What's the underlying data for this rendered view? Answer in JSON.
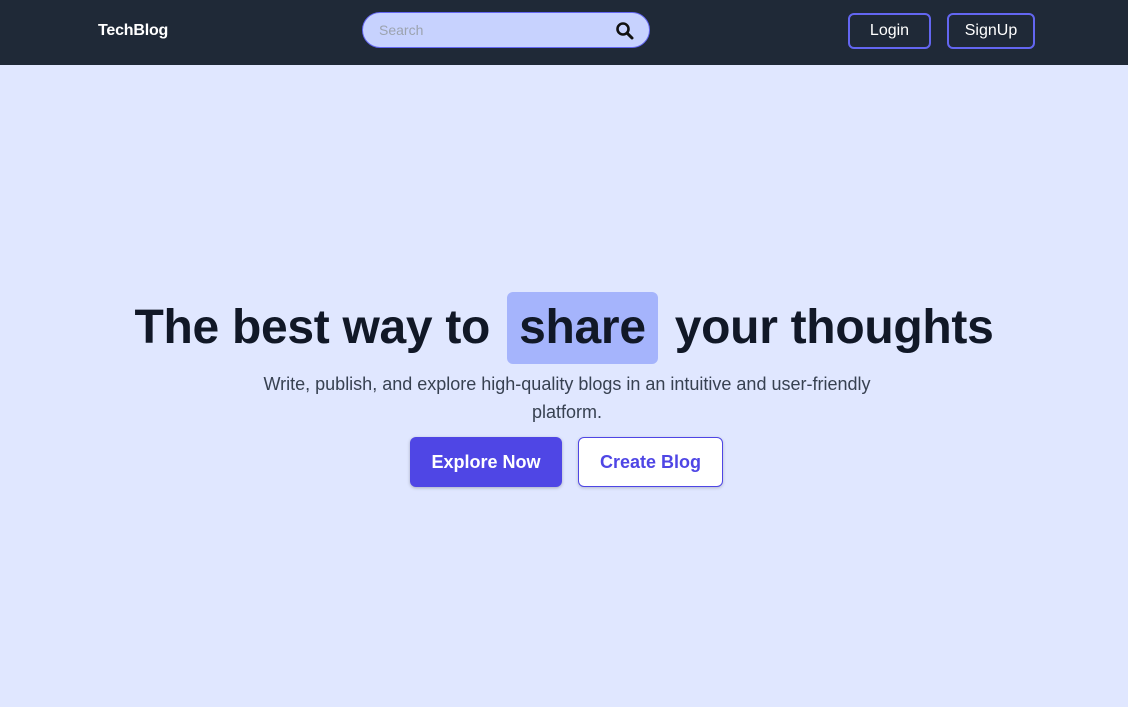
{
  "navbar": {
    "brand": "TechBlog",
    "search": {
      "placeholder": "Search",
      "value": "",
      "icon": "search-icon"
    },
    "login_label": "Login",
    "signup_label": "SignUp"
  },
  "hero": {
    "title_before": "The best way to",
    "title_highlight": "share",
    "title_after": "your thoughts",
    "subtitle": "Write, publish, and explore high-quality blogs in an intuitive and user-friendly platform.",
    "primary_cta": "Explore Now",
    "secondary_cta": "Create Blog"
  },
  "colors": {
    "navbar_bg": "#1f2937",
    "page_bg": "#e0e7ff",
    "accent": "#4f46e5",
    "highlight_bg": "#a5b4fc",
    "search_bg": "#c7d2fe",
    "button_border": "#6366f1"
  }
}
